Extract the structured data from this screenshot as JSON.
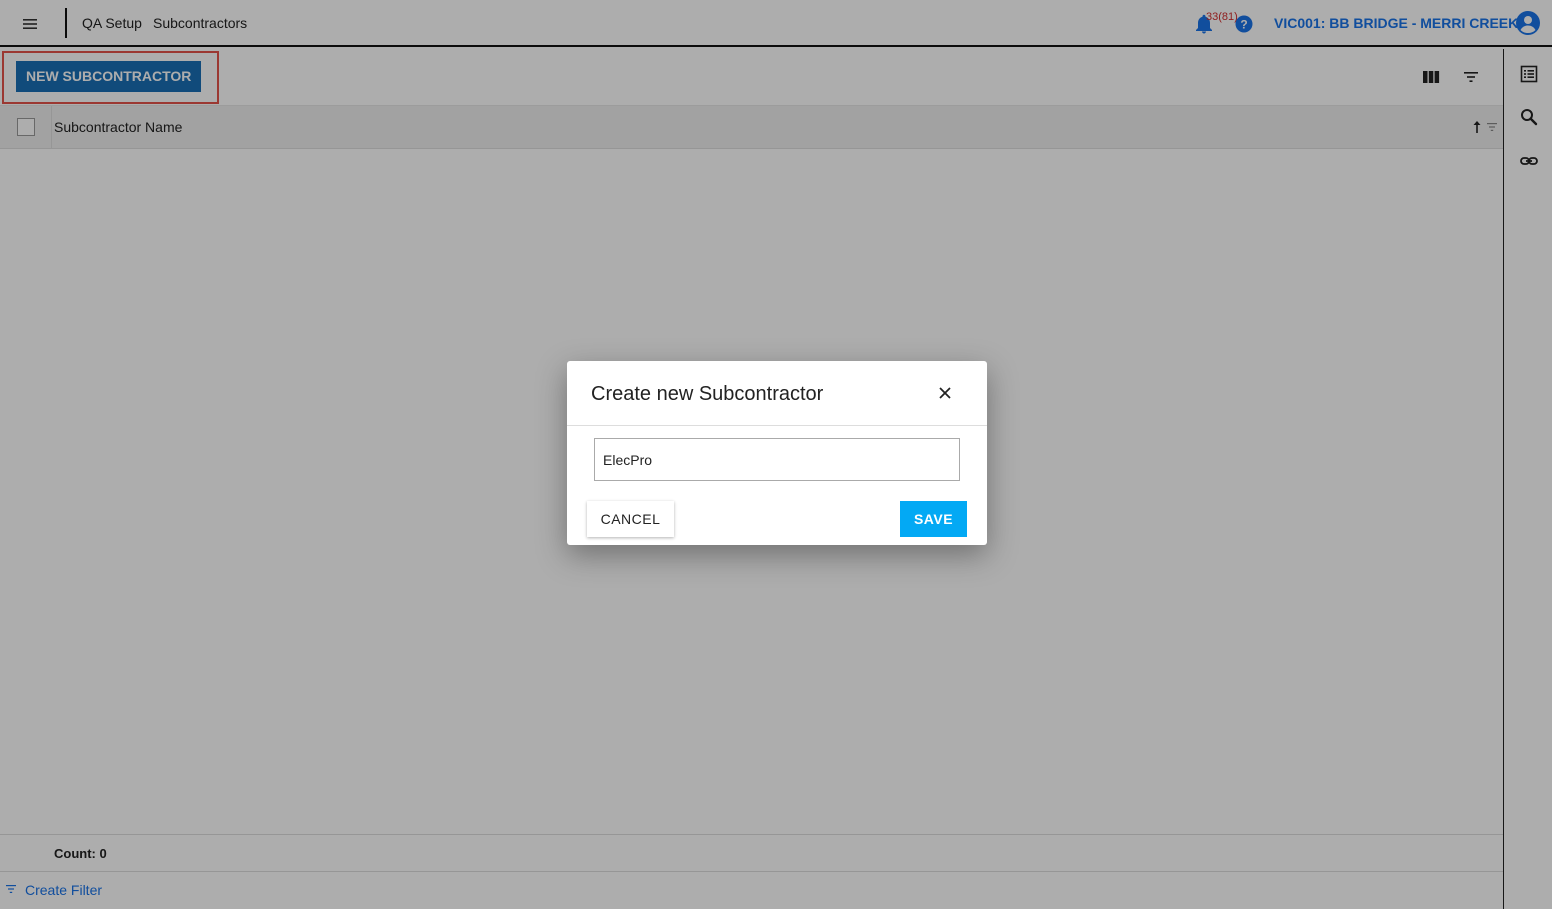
{
  "header": {
    "menu_icon": "hamburger-icon",
    "breadcrumbs": [
      "QA Setup",
      "Subcontractors"
    ],
    "notification_count": "33(81)",
    "project": "VIC001: BB BRIDGE - MERRI CREEK"
  },
  "toolbar": {
    "new_button_label": "NEW SUBCONTRACTOR"
  },
  "grid": {
    "column_header": "Subcontractor Name",
    "count_label": "Count: 0",
    "create_filter_label": "Create Filter"
  },
  "dialog": {
    "title": "Create new Subcontractor",
    "input_value": "ElecPro",
    "cancel_label": "CANCEL",
    "save_label": "SAVE"
  },
  "colors": {
    "primary_blue": "#1a6fb5",
    "link_blue": "#1a73e8",
    "save_blue": "#03a9f4",
    "highlight_red": "#e5534b"
  }
}
